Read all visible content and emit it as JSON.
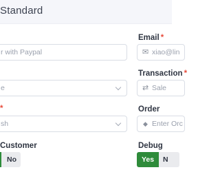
{
  "header": {
    "title": "Standard"
  },
  "payment_form": {
    "email": {
      "label": "Email",
      "required_mark": "*",
      "value": "xiao@lin",
      "icon": "envelope-icon"
    },
    "transaction": {
      "label": "Transaction",
      "required_mark": "*",
      "value": "Sale",
      "icon": "swap-arrows-icon"
    },
    "order": {
      "label": "Order",
      "placeholder": "Enter Orc",
      "icon": "diamond-icon"
    },
    "debug": {
      "label": "Debug",
      "yes": "Yes",
      "no": "N"
    },
    "left": {
      "title_field": {
        "value": "r with Paypal"
      },
      "type_field": {
        "value": "e"
      },
      "method": {
        "required_mark": "*",
        "value": "sh"
      },
      "customer": {
        "label": "Customer",
        "yes": "",
        "no": "No"
      }
    }
  }
}
